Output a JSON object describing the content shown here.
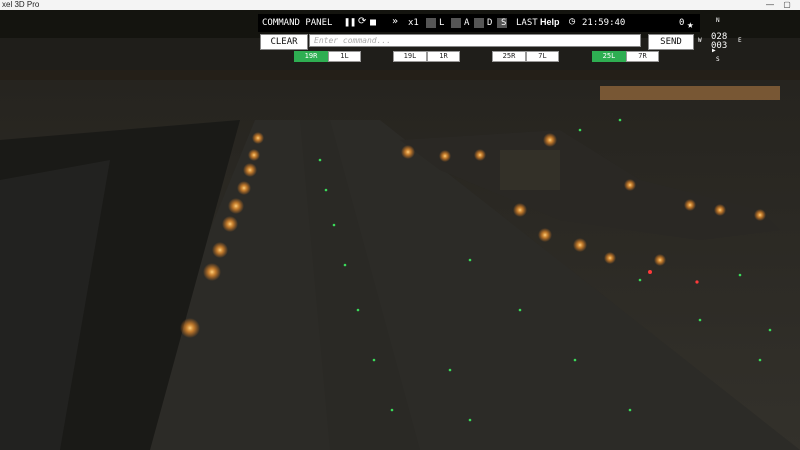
{
  "window": {
    "title": "xel 3D Pro"
  },
  "panel": {
    "title": "COMMAND PANEL",
    "speed": "x1",
    "toggles": [
      "L",
      "A",
      "D",
      "S"
    ],
    "last_label": "LAST",
    "help_label": "Help",
    "clock": "21:59:40",
    "star_count": "0"
  },
  "command": {
    "clear_label": "CLEAR",
    "placeholder": "Enter command...",
    "send_label": "SEND"
  },
  "runways": [
    {
      "label": "19R",
      "active": true
    },
    {
      "label": "1L",
      "active": false
    },
    {
      "label": "19L",
      "active": false
    },
    {
      "label": "1R",
      "active": false
    },
    {
      "label": "25R",
      "active": false
    },
    {
      "label": "7L",
      "active": false
    },
    {
      "label": "25L",
      "active": true
    },
    {
      "label": "7R",
      "active": false
    }
  ],
  "compass": {
    "n": "N",
    "w": "W",
    "e": "E",
    "s": "S",
    "heading": "028",
    "pitch": "003"
  },
  "colors": {
    "active_runway": "#2eae52",
    "panel_bg": "#000000"
  }
}
